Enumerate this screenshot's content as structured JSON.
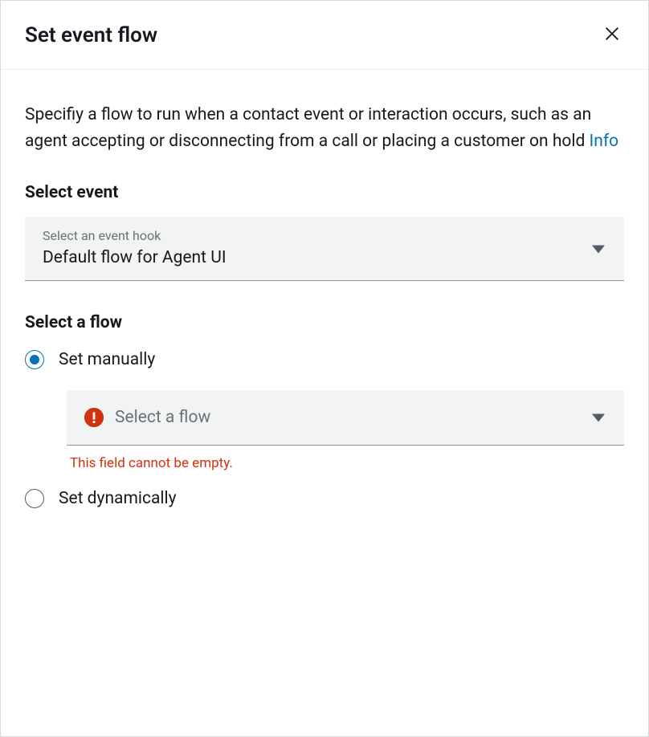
{
  "header": {
    "title": "Set event flow"
  },
  "description": {
    "text": "Specifiy a flow to run when a contact event or interaction occurs, such as an agent accepting or disconnecting from a call or placing a customer on hold ",
    "info_link": "Info"
  },
  "event_section": {
    "label": "Select event",
    "select_small_label": "Select an event hook",
    "select_value": "Default flow for Agent UI"
  },
  "flow_section": {
    "label": "Select a flow",
    "options": {
      "manual": "Set manually",
      "dynamic": "Set dynamically"
    },
    "flow_select_placeholder": "Select a flow",
    "error_message": "This field cannot be empty."
  }
}
